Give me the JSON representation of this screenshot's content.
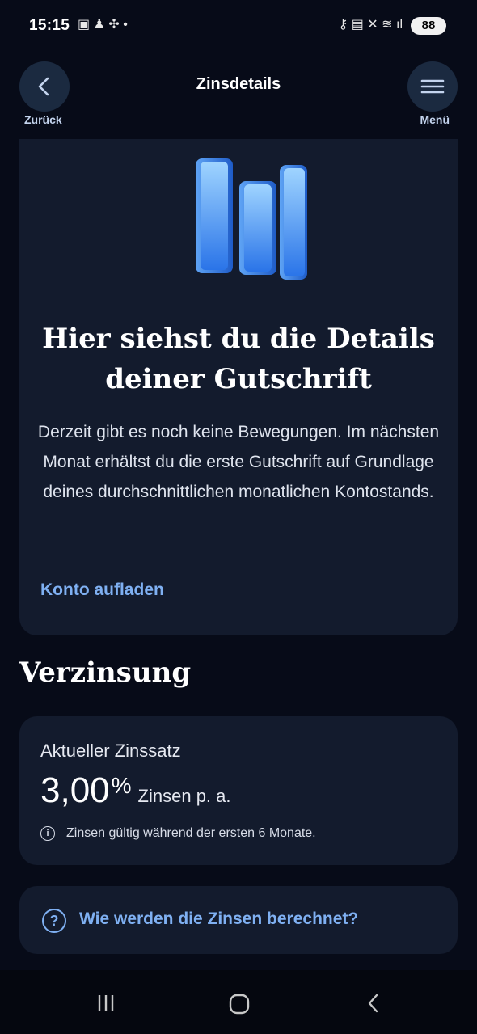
{
  "status_bar": {
    "time": "15:15",
    "left_icons": "▣ ♟ ✣ •",
    "right_icons": "⚷ ▤ ✕ ≋ ıl",
    "battery": "88"
  },
  "header": {
    "title": "Zinsdetails",
    "back_label": "Zurück",
    "menu_label": "Menü"
  },
  "hero": {
    "title": "Hier siehst du die Details deiner Gutschrift",
    "text": "Derzeit gibt es noch keine Bewegungen. Im nächsten Monat erhältst du die erste Gutschrift auf Grundlage deines durchschnittlichen monatlichen Kontostands.",
    "link": "Konto aufladen"
  },
  "interest": {
    "section_title": "Verzinsung",
    "label": "Aktueller Zinssatz",
    "value": "3,00",
    "percent": "%",
    "unit": "Zinsen p. a.",
    "note": "Zinsen gültig während der ersten 6 Monate."
  },
  "faq": {
    "text": "Wie werden die Zinsen berechnet?"
  },
  "colors": {
    "background": "#070b18",
    "card": "#131b2d",
    "accent": "#7fb0f2"
  }
}
